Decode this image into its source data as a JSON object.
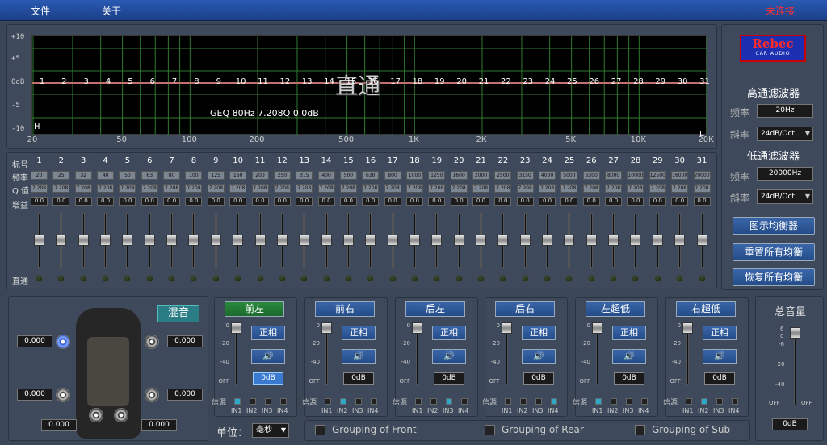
{
  "menu": {
    "file": "文件",
    "about": "关于",
    "status": "未连接"
  },
  "graph": {
    "y_labels": [
      "+10",
      "+5",
      "0dB",
      "-5",
      "-10"
    ],
    "x_labels": [
      "20",
      "50",
      "100",
      "200",
      "500",
      "1K",
      "2K",
      "5K",
      "10K",
      "20K"
    ],
    "overlay_title": "直通",
    "readout": "GEQ 80Hz 7.208Q 0.0dB",
    "hp_marker": "H",
    "lp_marker": "L"
  },
  "bands": {
    "row_labels": {
      "num": "标号",
      "freq": "频率",
      "q": "Q 值",
      "gain": "增益",
      "bypass": "直通"
    },
    "nums": [
      "1",
      "2",
      "3",
      "4",
      "5",
      "6",
      "7",
      "8",
      "9",
      "10",
      "11",
      "12",
      "13",
      "14",
      "15",
      "16",
      "17",
      "18",
      "19",
      "20",
      "21",
      "22",
      "23",
      "24",
      "25",
      "26",
      "27",
      "28",
      "29",
      "30",
      "31"
    ],
    "freqs": [
      "20",
      "25",
      "32",
      "40",
      "50",
      "63",
      "80",
      "100",
      "125",
      "160",
      "200",
      "250",
      "315",
      "400",
      "500",
      "630",
      "800",
      "1000",
      "1250",
      "1600",
      "2000",
      "2500",
      "3150",
      "4000",
      "5000",
      "6300",
      "8000",
      "10000",
      "12500",
      "16000",
      "20000"
    ],
    "q": "7.208",
    "gain": "0.0"
  },
  "filters": {
    "logo_main": "Rebec",
    "logo_sub": "CAR AUDIO",
    "highpass_title": "高通滤波器",
    "lowpass_title": "低通滤波器",
    "freq_label": "频率",
    "slope_label": "斜率",
    "hp_freq": "20Hz",
    "hp_slope": "24dB/Oct",
    "lp_freq": "20000Hz",
    "lp_slope": "24dB/Oct",
    "btn_graphic": "图示均衡器",
    "btn_reset": "重置所有均衡",
    "btn_restore": "恢复所有均衡"
  },
  "car": {
    "mix": "混音",
    "delays": [
      "0.000",
      "0.000",
      "0.000",
      "0.000",
      "0.000",
      "0.000"
    ]
  },
  "channels": [
    {
      "title": "前左",
      "gain": "0dB",
      "active": true,
      "src": [
        true,
        false,
        false,
        false
      ]
    },
    {
      "title": "前右",
      "gain": "0dB",
      "active": false,
      "src": [
        false,
        true,
        false,
        false
      ]
    },
    {
      "title": "后左",
      "gain": "0dB",
      "active": false,
      "src": [
        false,
        false,
        true,
        false
      ]
    },
    {
      "title": "后右",
      "gain": "0dB",
      "active": false,
      "src": [
        false,
        false,
        false,
        true
      ]
    },
    {
      "title": "左超低",
      "gain": "0dB",
      "active": false,
      "src": [
        true,
        false,
        false,
        false
      ]
    },
    {
      "title": "右超低",
      "gain": "0dB",
      "active": false,
      "src": [
        false,
        true,
        false,
        false
      ]
    }
  ],
  "channel_labels": {
    "phase": "正相",
    "source": "信源",
    "inputs": [
      "IN1",
      "IN2",
      "IN3",
      "IN4"
    ],
    "scale": [
      "0",
      "-20",
      "-40",
      "OFF"
    ],
    "mute_icon": "speaker-icon"
  },
  "unit": {
    "label": "单位：",
    "value": "毫秒"
  },
  "groups": {
    "front": "Grouping of Front",
    "rear": "Grouping of Rear",
    "sub": "Grouping of Sub"
  },
  "master": {
    "title": "总音量",
    "value": "0dB",
    "scale": [
      "6",
      "0",
      "-6",
      "-20",
      "-40",
      "OFF",
      "OFF"
    ]
  }
}
